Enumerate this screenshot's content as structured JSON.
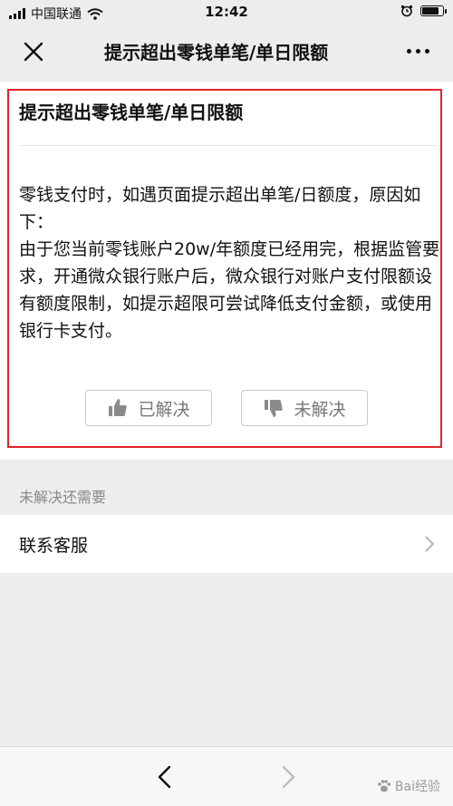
{
  "status_bar": {
    "carrier": "中国联通",
    "time": "12:42"
  },
  "nav": {
    "title": "提示超出零钱单笔/单日限额"
  },
  "article": {
    "title": "提示超出零钱单笔/单日限额",
    "paragraphs": [
      "零钱支付时，如遇页面提示超出单笔/日额度，原因如下：",
      "由于您当前零钱账户20w/年额度已经用完，根据监管要求，开通微众银行账户后，微众银行对账户支付限额设有额度限制，如提示超限可尝试降低支付金额，或使用银行卡支付。"
    ],
    "solved_label": "已解决",
    "unsolved_label": "未解决"
  },
  "section": {
    "label": "未解决还需要",
    "contact_label": "联系客服"
  },
  "watermark": {
    "text": "Bai经验"
  },
  "colors": {
    "highlight": "#e0242b",
    "background": "#ededed"
  },
  "icons": [
    "signal-icon",
    "wifi-icon",
    "alarm-icon",
    "battery-icon",
    "close-icon",
    "more-icon",
    "thumbs-up-icon",
    "thumbs-down-icon",
    "chevron-right-icon",
    "back-arrow-icon",
    "forward-arrow-icon"
  ]
}
